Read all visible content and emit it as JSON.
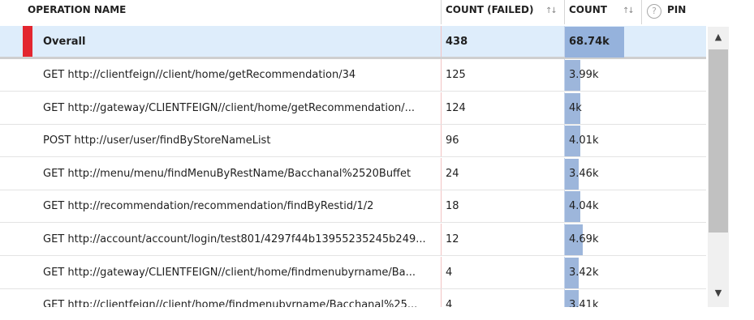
{
  "header": {
    "operation_name": "OPERATION NAME",
    "count_failed": "COUNT (FAILED)",
    "count": "COUNT",
    "pin": "PIN",
    "sort_glyph": "↑↓",
    "help_glyph": "?"
  },
  "overall": {
    "name": "Overall",
    "failed": "438",
    "count": "68.74k",
    "bar_fraction": 1.0
  },
  "rows": [
    {
      "name": "GET http://clientfeign//client/home/getRecommendation/34",
      "failed": "125",
      "count": "3.99k",
      "bar_fraction": 0.058
    },
    {
      "name": "GET http://gateway/CLIENTFEIGN//client/home/getRecommendation/...",
      "failed": "124",
      "count": "4k",
      "bar_fraction": 0.058
    },
    {
      "name": "POST http://user/user/findByStoreNameList",
      "failed": "96",
      "count": "4.01k",
      "bar_fraction": 0.058
    },
    {
      "name": "GET http://menu/menu/findMenuByRestName/Bacchanal%2520Buffet",
      "failed": "24",
      "count": "3.46k",
      "bar_fraction": 0.05
    },
    {
      "name": "GET http://recommendation/recommendation/findByRestid/1/2",
      "failed": "18",
      "count": "4.04k",
      "bar_fraction": 0.059
    },
    {
      "name": "GET http://account/account/login/test801/4297f44b13955235245b249...",
      "failed": "12",
      "count": "4.69k",
      "bar_fraction": 0.068
    },
    {
      "name": "GET http://gateway/CLIENTFEIGN//client/home/findmenubyrname/Ba...",
      "failed": "4",
      "count": "3.42k",
      "bar_fraction": 0.05
    },
    {
      "name": "GET http://clientfeign//client/home/findmenubyrname/Bacchanal%25...",
      "failed": "4",
      "count": "3.41k",
      "bar_fraction": 0.05
    }
  ],
  "scrollbar": {
    "up_glyph": "▲",
    "down_glyph": "▼"
  },
  "colors": {
    "accent_bar": "#9db6db",
    "overall_marker": "#e3262f",
    "overall_bg": "#deedfb"
  }
}
